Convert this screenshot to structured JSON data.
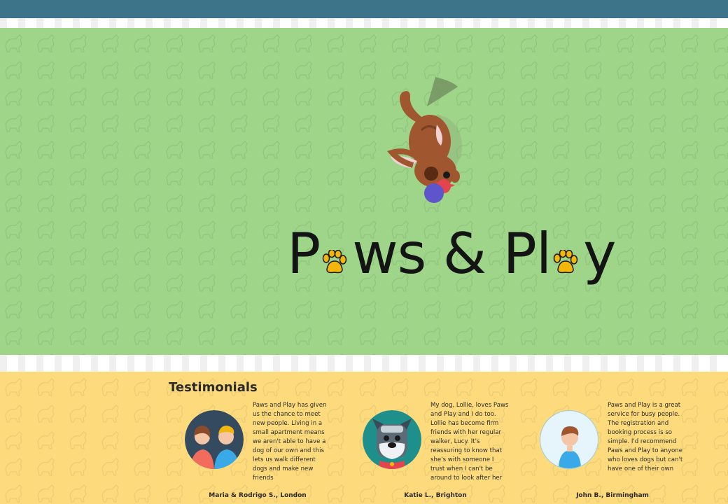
{
  "hero": {
    "logo_part1": "P",
    "logo_part2": "ws & Pl",
    "logo_part3": "y"
  },
  "testimonials": {
    "heading": "Testimonials",
    "items": [
      {
        "quote": "Paws and Play has given us the chance to meet new people. Living in a small apartment means we aren't able to have a dog of our own and this lets us walk different dogs and make new friends",
        "author": "Maria & Rodrigo S., London",
        "avatar": "couple-avatar-icon"
      },
      {
        "quote": "My dog, Lollie, loves Paws and Play and I do too. Lollie has become firm friends with her regular walker, Lucy. It's reassuring to know that she's with someone I trust when I can't be around to look after her",
        "author": "Katie L., Brighton",
        "avatar": "schnauzer-dog-avatar-icon"
      },
      {
        "quote": "Paws and Play is a great service for busy people. The registration and booking process is so simple. I'd recommend Paws and Play to anyone who loves dogs but can't have one of their own",
        "author": "John B., Birmingham",
        "avatar": "man-avatar-icon"
      }
    ]
  },
  "colors": {
    "top_bar": "#3e7489",
    "hero_background": "#9ed589",
    "testimonials_background": "#fddb7d",
    "paw_accent": "#f5b60c"
  }
}
